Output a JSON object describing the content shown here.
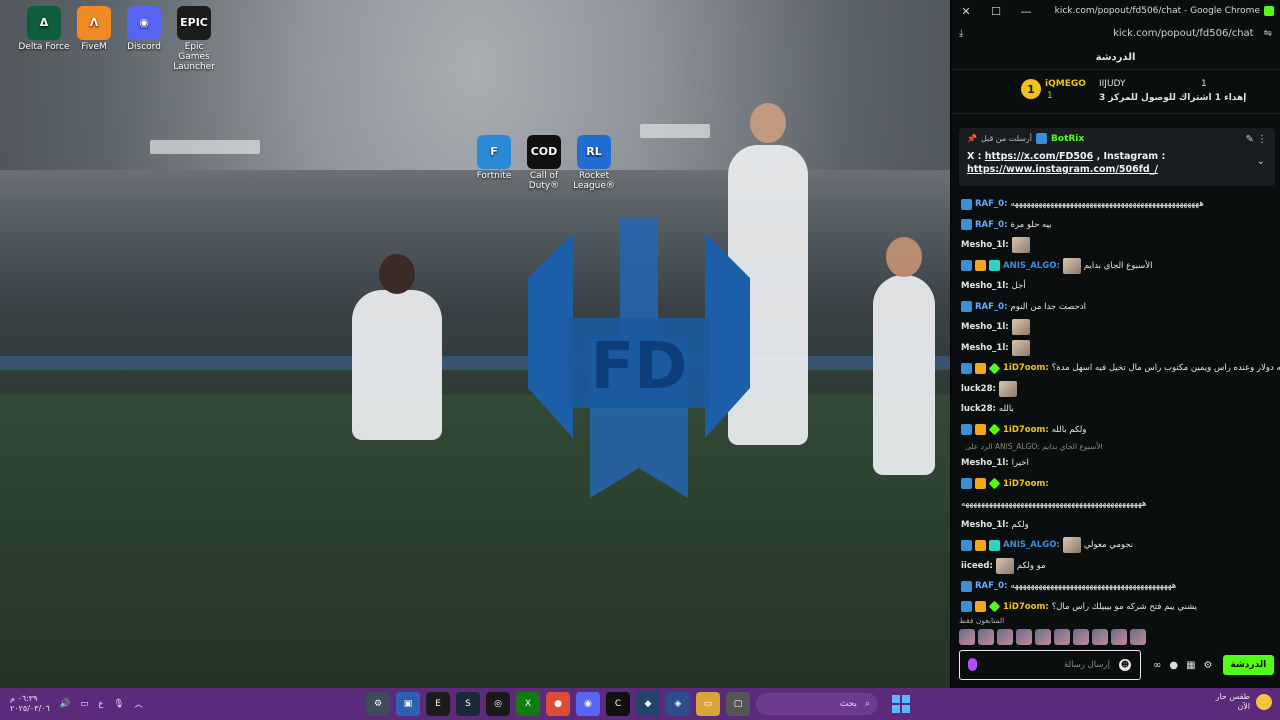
{
  "desktop": {
    "icons": [
      {
        "label": "Delta Force",
        "color": "#0f5d3a",
        "glyph": "Δ"
      },
      {
        "label": "FiveM",
        "color": "#f08a24",
        "glyph": "Λ"
      },
      {
        "label": "Discord",
        "color": "#5865f2",
        "glyph": "◉"
      },
      {
        "label": "Epic Games Launcher",
        "color": "#1c1c1c",
        "glyph": "EPIC"
      }
    ],
    "center_icons": [
      {
        "label": "Fortnite",
        "color": "#2a8ad8",
        "glyph": "F"
      },
      {
        "label": "Call of Duty®",
        "color": "#111111",
        "glyph": "COD"
      },
      {
        "label": "Rocket League®",
        "color": "#1f6fd1",
        "glyph": "RL"
      }
    ],
    "wallpaper_logo_text": "FD"
  },
  "browser": {
    "title": "kick.com/popout/fd506/chat - Google Chrome",
    "url": "kick.com/popout/fd506/chat",
    "chat_header": "الدردشة",
    "leaderboard": {
      "rank": "1",
      "first_name": "iQMEGO",
      "first_count": "1",
      "second_name": "IIJUDY",
      "second_count": "1",
      "gift_text": "إهداء 1 اشتراك للوصول للمركز 3"
    },
    "pinned": {
      "sent_by": "أرسلت من قبل",
      "bot": "BotRix",
      "text_prefix": "X : ",
      "x_link": "https://x.com/FD506",
      "middle": " , Instagram :",
      "ig_link": "https://www.instagram.com/506fd_/"
    },
    "messages": [
      {
        "user": "RAF_0",
        "color": "#6aa8ff",
        "badges": [
          "blue"
        ],
        "text": "ههههههههههههههههههههههههههههههههههههههههههههههههه"
      },
      {
        "user": "RAF_0",
        "color": "#6aa8ff",
        "badges": [
          "blue"
        ],
        "text": "ييه حلو مرة"
      },
      {
        "user": "Mesho_1l",
        "color": "#e6e6e6",
        "badges": [],
        "emote": true,
        "text": ""
      },
      {
        "user": "ANIS_ALGO",
        "color": "#3a8fd6",
        "badges": [
          "blue",
          "gold",
          "cyan"
        ],
        "emote": true,
        "text": "الأسبوع الجاي بدايم"
      },
      {
        "user": "Mesho_1l",
        "color": "#e6e6e6",
        "badges": [],
        "text": "أجل"
      },
      {
        "user": "RAF_0",
        "color": "#6aa8ff",
        "badges": [
          "blue"
        ],
        "text": "ادحصت جدا من النوم"
      },
      {
        "user": "Mesho_1l",
        "color": "#e6e6e6",
        "badges": [],
        "emote": true,
        "text": ""
      },
      {
        "user": "Mesho_1l",
        "color": "#e6e6e6",
        "badges": [],
        "emote": true,
        "text": ""
      },
      {
        "user": "1iD7oom",
        "color": "#f1c21b",
        "badges": [
          "blue",
          "gold",
          "green"
        ],
        "text": "قلت له دولار وعنده راس ويمين مكتوب راس مال تخيل فيه اسهل مدة؟"
      },
      {
        "user": "luck28",
        "color": "#e6e6e6",
        "badges": [],
        "emote": true,
        "text": ""
      },
      {
        "user": "luck28",
        "color": "#e6e6e6",
        "badges": [],
        "text": "بالله"
      },
      {
        "user": "1iD7oom",
        "color": "#f1c21b",
        "badges": [
          "blue",
          "gold",
          "green"
        ],
        "text": "ولكم بالله"
      },
      {
        "reply": true,
        "text": "الرد على ANIS_ALGO: الأسبوع الجاي بدايم"
      },
      {
        "user": "Mesho_1l",
        "color": "#e6e6e6",
        "badges": [],
        "text": "اخيرا"
      },
      {
        "user": "1iD7oom",
        "color": "#f1c21b",
        "badges": [
          "blue",
          "gold",
          "green"
        ],
        "text": ""
      },
      {
        "user": "",
        "color": "#e6e6e6",
        "badges": [],
        "text": "ههههههههههههههههههههههههههههههههههههههههههههههه"
      },
      {
        "user": "Mesho_1l",
        "color": "#e6e6e6",
        "badges": [],
        "text": "ولكم"
      },
      {
        "user": "ANIS_ALGO",
        "color": "#3a8fd6",
        "badges": [
          "blue",
          "gold",
          "cyan"
        ],
        "emote": true,
        "text": "نجومي معولي"
      },
      {
        "user": "iiceed",
        "color": "#e6e6e6",
        "badges": [],
        "emote": true,
        "text": "مو ولكم"
      },
      {
        "user": "RAF_0",
        "color": "#6aa8ff",
        "badges": [
          "blue"
        ],
        "text": "هههههههههههههههههههههههههههههههههههههههههه"
      },
      {
        "user": "1iD7oom",
        "color": "#f1c21b",
        "badges": [
          "blue",
          "gold",
          "green"
        ],
        "text": "يشني يبم فتح شركه مو بيبيلك راس مال؟"
      }
    ],
    "viewers_label": "المتابعون فقط",
    "input_placeholder": "إرسال رسالة",
    "send_label": "الدردشة"
  },
  "taskbar": {
    "clock_time": "٠٦:٣٩ م",
    "clock_date": "٢٠٢٥/٠٣/٠٦",
    "lang": "ع",
    "search_placeholder": "بحث",
    "weather_line1": "طقس حار",
    "weather_line2": "الآن",
    "apps": [
      {
        "name": "settings",
        "color": "#3f4a5c",
        "glyph": "⚙"
      },
      {
        "name": "store",
        "color": "#2f5fb0",
        "glyph": "▣"
      },
      {
        "name": "epic",
        "color": "#1c1c1c",
        "glyph": "E"
      },
      {
        "name": "steam",
        "color": "#1b2838",
        "glyph": "S"
      },
      {
        "name": "obs",
        "color": "#1a1a1a",
        "glyph": "◎"
      },
      {
        "name": "xbox",
        "color": "#107c10",
        "glyph": "X"
      },
      {
        "name": "chrome",
        "color": "#dd4b39",
        "glyph": "●"
      },
      {
        "name": "discord",
        "color": "#5865f2",
        "glyph": "◉"
      },
      {
        "name": "cod",
        "color": "#111111",
        "glyph": "C"
      },
      {
        "name": "valorant",
        "color": "#22446a",
        "glyph": "◆"
      },
      {
        "name": "shield",
        "color": "#2c4f8c",
        "glyph": "◈"
      },
      {
        "name": "files",
        "color": "#d9a43a",
        "glyph": "▭"
      },
      {
        "name": "app",
        "color": "#555555",
        "glyph": "▢"
      }
    ]
  }
}
